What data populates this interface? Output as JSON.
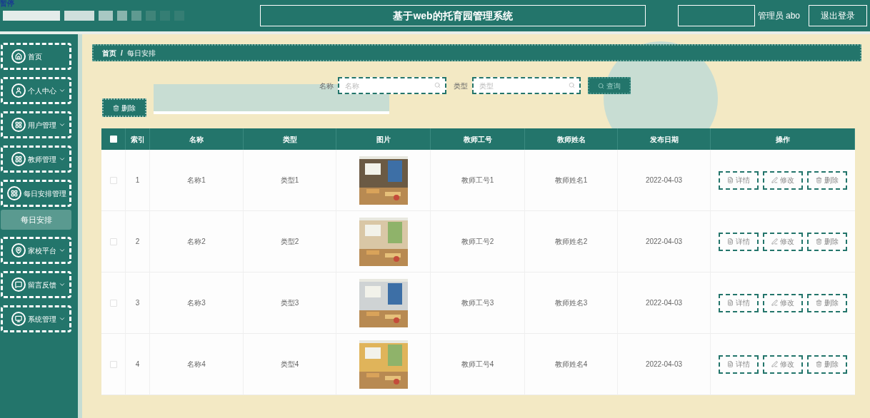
{
  "overlay_label": "暂停",
  "header": {
    "title": "基于web的托育园管理系统",
    "user": "管理员 abo",
    "logout": "退出登录"
  },
  "sidebar": {
    "items": [
      {
        "label": "首页",
        "has_arrow": false,
        "expanded": false,
        "selected": false
      },
      {
        "label": "个人中心",
        "has_arrow": true,
        "expanded": false,
        "selected": false
      },
      {
        "label": "用户管理",
        "has_arrow": true,
        "expanded": false,
        "selected": false
      },
      {
        "label": "教师管理",
        "has_arrow": true,
        "expanded": false,
        "selected": false
      },
      {
        "label": "每日安排管理",
        "has_arrow": false,
        "expanded": true,
        "selected": false,
        "children": [
          {
            "label": "每日安排",
            "selected": true
          }
        ]
      },
      {
        "label": "家校平台",
        "has_arrow": true,
        "expanded": false,
        "selected": false
      },
      {
        "label": "留言反馈",
        "has_arrow": true,
        "expanded": false,
        "selected": false
      },
      {
        "label": "系统管理",
        "has_arrow": true,
        "expanded": false,
        "selected": false
      }
    ]
  },
  "breadcrumb": {
    "items": [
      "首页",
      "每日安排"
    ],
    "separator": "/"
  },
  "search": {
    "fields": [
      {
        "label": "名称",
        "placeholder": "名称"
      },
      {
        "label": "类型",
        "placeholder": "类型"
      }
    ],
    "button": "查询"
  },
  "delete_button": "删除",
  "table": {
    "select_all_checked": false,
    "columns": [
      "索引",
      "名称",
      "类型",
      "图片",
      "教师工号",
      "教师姓名",
      "发布日期",
      "操作"
    ],
    "rows": [
      {
        "checked": false,
        "cells": [
          "1",
          "名称1",
          "类型1",
          null,
          "教师工号1",
          "教师姓名1",
          "2022-04-03"
        ],
        "actions": [
          "详情",
          "修改",
          "删除"
        ]
      },
      {
        "checked": false,
        "cells": [
          "2",
          "名称2",
          "类型2",
          null,
          "教师工号2",
          "教师姓名2",
          "2022-04-03"
        ],
        "actions": [
          "详情",
          "修改",
          "删除"
        ]
      },
      {
        "checked": false,
        "cells": [
          "3",
          "名称3",
          "类型3",
          null,
          "教师工号3",
          "教师姓名3",
          "2022-04-03"
        ],
        "actions": [
          "详情",
          "修改",
          "删除"
        ]
      },
      {
        "checked": false,
        "cells": [
          "4",
          "名称4",
          "类型4",
          null,
          "教师工号4",
          "教师姓名4",
          "2022-04-03"
        ],
        "actions": [
          "详情",
          "修改",
          "删除"
        ]
      }
    ]
  }
}
